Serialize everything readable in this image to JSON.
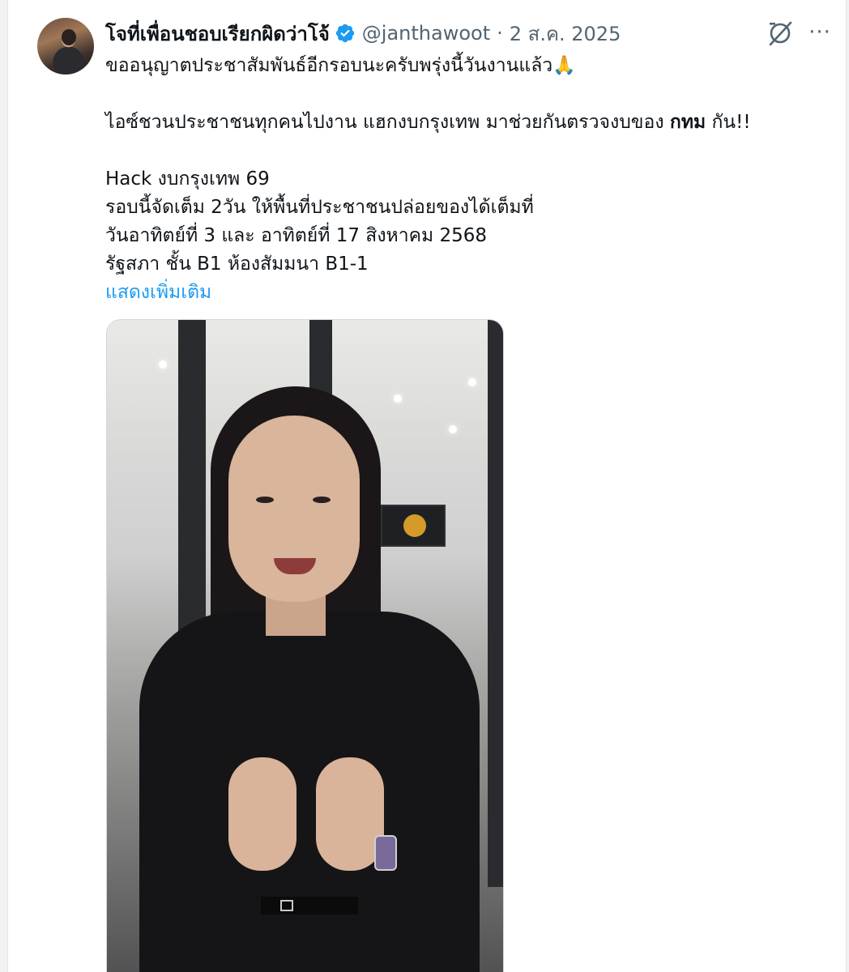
{
  "tweet": {
    "display_name": "โจที่เพื่อนชอบเรียกผิดว่าโจ้",
    "handle": "@janthawoot",
    "separator": "·",
    "timestamp": "2 ส.ค. 2025",
    "more_label": "···",
    "lines": {
      "l1": "ขออนุญาตประชาสัมพันธ์อีกรอบนะครับพรุ่งนี้วันงานแล้ว🙏",
      "l2a": "ไอซ์ชวนประชาชนทุกคนไปงาน แฮกงบกรุงเทพ มาช่วยกันตรวจงบของ ",
      "l2b": "กทม",
      "l2c": " กัน!!",
      "l3": "Hack งบกรุงเทพ 69",
      "l4": "รอบนี้จัดเต็ม 2วัน ให้พื้นที่ประชาชนปล่อยของได้เต็มที่",
      "l5": "วันอาทิตย์ที่ 3 และ อาทิตย์ที่ 17 สิงหาคม 2568",
      "l6": "รัฐสภา ชั้น B1 ห้องสัมมนา B1-1"
    },
    "show_more": "แสดงเพิ่มเติม"
  },
  "icons": {
    "verified": "verified-badge-icon",
    "grok": "grok-icon",
    "more": "more-options-icon"
  },
  "colors": {
    "link": "#1d9bf0",
    "verified": "#1d9bf0",
    "secondary_text": "#536471"
  }
}
